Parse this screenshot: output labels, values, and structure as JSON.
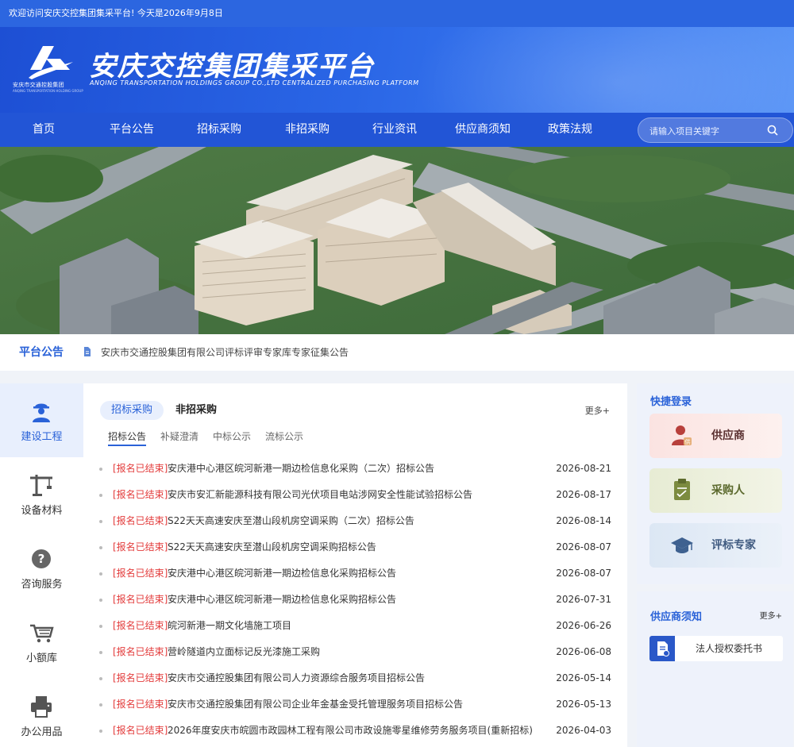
{
  "topbar": {
    "welcome": "欢迎访问安庆交控集团集采平台! 今天是2026年9月8日"
  },
  "header": {
    "logo_text": "安庆市交通控股集团",
    "logo_sub": "ANQING TRANSPORTATION HOLDING GROUP",
    "title": "安庆交控集团集采平台",
    "subtitle": "ANQING TRANSPORTATION HOLDINGS GROUP CO.,LTD CENTRALIZED PURCHASING PLATFORM"
  },
  "nav": {
    "items": [
      {
        "label": "首页"
      },
      {
        "label": "平台公告"
      },
      {
        "label": "招标采购"
      },
      {
        "label": "非招采购"
      },
      {
        "label": "行业资讯"
      },
      {
        "label": "供应商须知"
      },
      {
        "label": "政策法规"
      }
    ],
    "search_placeholder": "请输入项目关键字"
  },
  "banner": {
    "slide_count": 5,
    "active_slide": 2
  },
  "notice": {
    "title": "平台公告",
    "text": "安庆市交通控股集团有限公司评标评审专家库专家征集公告"
  },
  "categories": [
    {
      "label": "建设工程",
      "icon": "worker-icon"
    },
    {
      "label": "设备材料",
      "icon": "crane-icon"
    },
    {
      "label": "咨询服务",
      "icon": "question-icon"
    },
    {
      "label": "小额库",
      "icon": "cart-icon"
    },
    {
      "label": "办公用品",
      "icon": "printer-icon"
    }
  ],
  "main": {
    "tabs": [
      {
        "label": "招标采购"
      },
      {
        "label": "非招采购"
      }
    ],
    "more": "更多+",
    "subtabs": [
      {
        "label": "招标公告"
      },
      {
        "label": "补疑澄清"
      },
      {
        "label": "中标公示"
      },
      {
        "label": "流标公示"
      }
    ],
    "rows": [
      {
        "tag": "[报名已结束]",
        "title": "安庆港中心港区皖河新港一期边检信息化采购（二次）招标公告",
        "date": "2026-08-21"
      },
      {
        "tag": "[报名已结束]",
        "title": "安庆市安汇新能源科技有限公司光伏项目电站涉网安全性能试验招标公告",
        "date": "2026-08-17"
      },
      {
        "tag": "[报名已结束]",
        "title": "S22天天高速安庆至潜山段机房空调采购（二次）招标公告",
        "date": "2026-08-14"
      },
      {
        "tag": "[报名已结束]",
        "title": "S22天天高速安庆至潜山段机房空调采购招标公告",
        "date": "2026-08-07"
      },
      {
        "tag": "[报名已结束]",
        "title": "安庆港中心港区皖河新港一期边检信息化采购招标公告",
        "date": "2026-08-07"
      },
      {
        "tag": "[报名已结束]",
        "title": "安庆港中心港区皖河新港一期边检信息化采购招标公告",
        "date": "2026-07-31"
      },
      {
        "tag": "[报名已结束]",
        "title": "皖河新港一期文化墙施工项目",
        "date": "2026-06-26"
      },
      {
        "tag": "[报名已结束]",
        "title": "营岭隧道内立面标记反光漆施工采购",
        "date": "2026-06-08"
      },
      {
        "tag": "[报名已结束]",
        "title": "安庆市交通控股集团有限公司人力资源综合服务项目招标公告",
        "date": "2026-05-14"
      },
      {
        "tag": "[报名已结束]",
        "title": "安庆市交通控股集团有限公司企业年金基金受托管理服务项目招标公告",
        "date": "2026-05-13"
      },
      {
        "tag": "[报名已结束]",
        "title": "2026年度安庆市皖圆市政园林工程有限公司市政设施零星维修劳务服务项目(重新招标)",
        "date": "2026-04-03"
      }
    ]
  },
  "quick_login": {
    "title": "快捷登录",
    "buttons": [
      {
        "label": "供应商",
        "icon": "supplier-icon",
        "color": "#c0504d"
      },
      {
        "label": "采购人",
        "icon": "clipboard-icon",
        "color": "#8a9a4a"
      },
      {
        "label": "评标专家",
        "icon": "graduation-cap-icon",
        "color": "#4a6e9a"
      }
    ]
  },
  "supplier_notice": {
    "title": "供应商须知",
    "more": "更多+",
    "doc": "法人授权委托书"
  }
}
